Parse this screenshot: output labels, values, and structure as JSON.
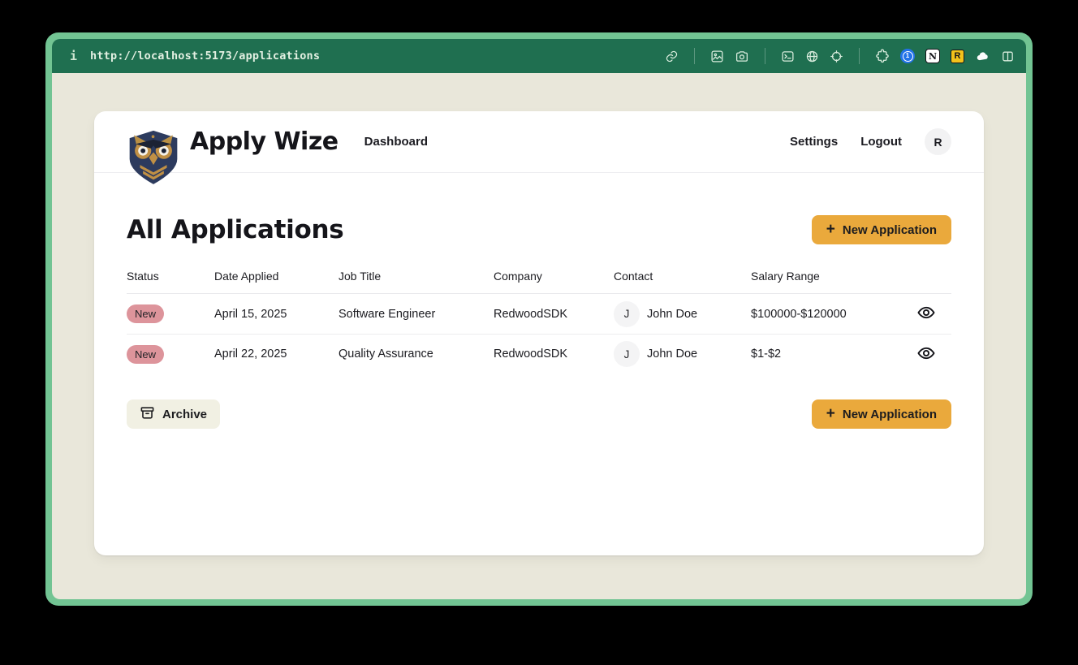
{
  "browser": {
    "info_glyph": "i",
    "url": "http://localhost:5173/applications",
    "extension_badges": {
      "onepassword": "1",
      "notion": "N",
      "r": "R"
    }
  },
  "header": {
    "app_name": "Apply Wize",
    "dashboard_label": "Dashboard",
    "settings_label": "Settings",
    "logout_label": "Logout",
    "avatar_initial": "R"
  },
  "main": {
    "title": "All Applications",
    "plus_glyph": "+",
    "new_application_label": "New Application",
    "archive_label": "Archive",
    "table": {
      "columns": [
        "Status",
        "Date Applied",
        "Job Title",
        "Company",
        "Contact",
        "Salary Range"
      ],
      "rows": [
        {
          "status": "New",
          "date_applied": "April 15, 2025",
          "job_title": "Software Engineer",
          "company": "RedwoodSDK",
          "contact_initial": "J",
          "contact_name": "John Doe",
          "salary_range": "$100000-$120000"
        },
        {
          "status": "New",
          "date_applied": "April 22, 2025",
          "job_title": "Quality Assurance",
          "company": "RedwoodSDK",
          "contact_initial": "J",
          "contact_name": "John Doe",
          "salary_range": "$1-$2"
        }
      ]
    }
  },
  "colors": {
    "frame_green": "#72c493",
    "chrome_green": "#1f6f50",
    "page_beige": "#e9e7da",
    "accent_yellow": "#eaa93c",
    "badge_pink": "#dd949b"
  }
}
